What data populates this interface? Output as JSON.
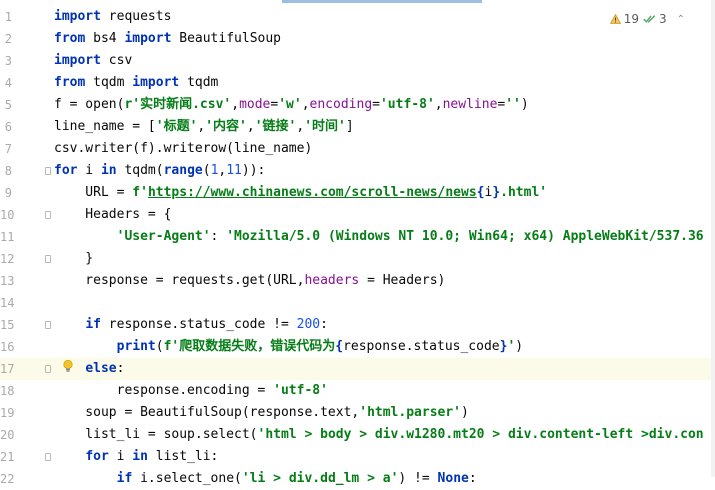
{
  "editor": {
    "inspection": {
      "warnings": "19",
      "weak_warnings": "3"
    },
    "lines": [
      {
        "n": "1",
        "tokens": [
          [
            "kw",
            "import"
          ],
          [
            "plain",
            " requests"
          ]
        ]
      },
      {
        "n": "2",
        "tokens": [
          [
            "kw",
            "from"
          ],
          [
            "plain",
            " bs4 "
          ],
          [
            "kw",
            "import"
          ],
          [
            "plain",
            " BeautifulSoup"
          ]
        ]
      },
      {
        "n": "3",
        "tokens": [
          [
            "kw",
            "import"
          ],
          [
            "plain",
            " csv"
          ]
        ]
      },
      {
        "n": "4",
        "tokens": [
          [
            "kw",
            "from"
          ],
          [
            "plain",
            " tqdm "
          ],
          [
            "kw",
            "import"
          ],
          [
            "plain",
            " tqdm"
          ]
        ]
      },
      {
        "n": "5",
        "tokens": [
          [
            "plain",
            "f = open("
          ],
          [
            "str",
            "r'实时新闻.csv'"
          ],
          [
            "plain",
            ","
          ],
          [
            "param",
            "mode"
          ],
          [
            "plain",
            "="
          ],
          [
            "str",
            "'w'"
          ],
          [
            "plain",
            ","
          ],
          [
            "param",
            "encoding"
          ],
          [
            "plain",
            "="
          ],
          [
            "str",
            "'utf-8'"
          ],
          [
            "plain",
            ","
          ],
          [
            "param",
            "newline"
          ],
          [
            "plain",
            "="
          ],
          [
            "str",
            "''"
          ],
          [
            "plain",
            ")"
          ]
        ]
      },
      {
        "n": "6",
        "tokens": [
          [
            "plain",
            "line_name = ["
          ],
          [
            "str",
            "'标题'"
          ],
          [
            "plain",
            ","
          ],
          [
            "str",
            "'内容'"
          ],
          [
            "plain",
            ","
          ],
          [
            "str",
            "'链接'"
          ],
          [
            "plain",
            ","
          ],
          [
            "str",
            "'时间'"
          ],
          [
            "plain",
            "]"
          ]
        ]
      },
      {
        "n": "7",
        "tokens": [
          [
            "plain",
            "csv.writer(f).writerow(line_name)"
          ]
        ]
      },
      {
        "n": "8",
        "tokens": [
          [
            "kw",
            "for"
          ],
          [
            "plain",
            " i "
          ],
          [
            "kw",
            "in"
          ],
          [
            "plain",
            " tqdm("
          ],
          [
            "kw",
            "range"
          ],
          [
            "plain",
            "("
          ],
          [
            "num",
            "1"
          ],
          [
            "plain",
            ","
          ],
          [
            "num",
            "11"
          ],
          [
            "plain",
            ")):"
          ]
        ]
      },
      {
        "n": "9",
        "tokens": [
          [
            "plain",
            "    URL = "
          ],
          [
            "str",
            "f'"
          ],
          [
            "link",
            "https://www.chinanews.com/scroll-news/news"
          ],
          [
            "brace",
            "{"
          ],
          [
            "plain",
            "i"
          ],
          [
            "brace",
            "}"
          ],
          [
            "str",
            ".html'"
          ]
        ]
      },
      {
        "n": "10",
        "tokens": [
          [
            "plain",
            "    Headers = {"
          ]
        ]
      },
      {
        "n": "11",
        "tokens": [
          [
            "plain",
            "        "
          ],
          [
            "str",
            "'User-Agent'"
          ],
          [
            "plain",
            ": "
          ],
          [
            "str",
            "'Mozilla/5.0 (Windows NT 10.0; Win64; x64) AppleWebKit/537.36"
          ]
        ]
      },
      {
        "n": "12",
        "tokens": [
          [
            "plain",
            "    }"
          ]
        ]
      },
      {
        "n": "13",
        "tokens": [
          [
            "plain",
            "    response = requests.get(URL,"
          ],
          [
            "param",
            "headers"
          ],
          [
            "plain",
            " = Headers)"
          ]
        ]
      },
      {
        "n": "14",
        "tokens": []
      },
      {
        "n": "15",
        "tokens": [
          [
            "plain",
            "    "
          ],
          [
            "kw",
            "if"
          ],
          [
            "plain",
            " response.status_code != "
          ],
          [
            "num",
            "200"
          ],
          [
            "plain",
            ":"
          ]
        ]
      },
      {
        "n": "16",
        "tokens": [
          [
            "plain",
            "        "
          ],
          [
            "kw",
            "print"
          ],
          [
            "plain",
            "("
          ],
          [
            "str",
            "f'爬取数据失败，错误代码为"
          ],
          [
            "brace",
            "{"
          ],
          [
            "plain",
            "response.status_code"
          ],
          [
            "brace",
            "}"
          ],
          [
            "str",
            "'"
          ],
          [
            "plain",
            ")"
          ]
        ]
      },
      {
        "n": "17",
        "tokens": [
          [
            "plain",
            "    "
          ],
          [
            "kw",
            "else"
          ],
          [
            "plain",
            ":"
          ]
        ]
      },
      {
        "n": "18",
        "tokens": [
          [
            "plain",
            "        response.encoding = "
          ],
          [
            "str",
            "'utf-8'"
          ]
        ]
      },
      {
        "n": "19",
        "tokens": [
          [
            "plain",
            "    soup = BeautifulSoup(response.text,"
          ],
          [
            "str",
            "'html.parser'"
          ],
          [
            "plain",
            ")"
          ]
        ]
      },
      {
        "n": "20",
        "tokens": [
          [
            "plain",
            "    list_li = soup.select("
          ],
          [
            "str",
            "'html > body > div.w1280.mt20 > div.content-left >div.con"
          ]
        ]
      },
      {
        "n": "21",
        "tokens": [
          [
            "plain",
            "    "
          ],
          [
            "kw",
            "for"
          ],
          [
            "plain",
            " i "
          ],
          [
            "kw",
            "in"
          ],
          [
            "plain",
            " list_li:"
          ]
        ]
      },
      {
        "n": "22",
        "tokens": [
          [
            "plain",
            "        "
          ],
          [
            "kw",
            "if"
          ],
          [
            "plain",
            " i.select_one("
          ],
          [
            "str",
            "'li > div.dd_lm > a'"
          ],
          [
            "plain",
            ") != "
          ],
          [
            "kw",
            "None"
          ],
          [
            "plain",
            ":"
          ]
        ]
      }
    ]
  },
  "icons": {
    "warning": "warning-triangle-icon",
    "check": "double-check-icon",
    "bulb": "lightbulb-icon"
  },
  "colors": {
    "keyword": "#0033b3",
    "string": "#067d17",
    "number": "#1750eb",
    "param": "#871094",
    "current_line": "#fcfae9"
  }
}
